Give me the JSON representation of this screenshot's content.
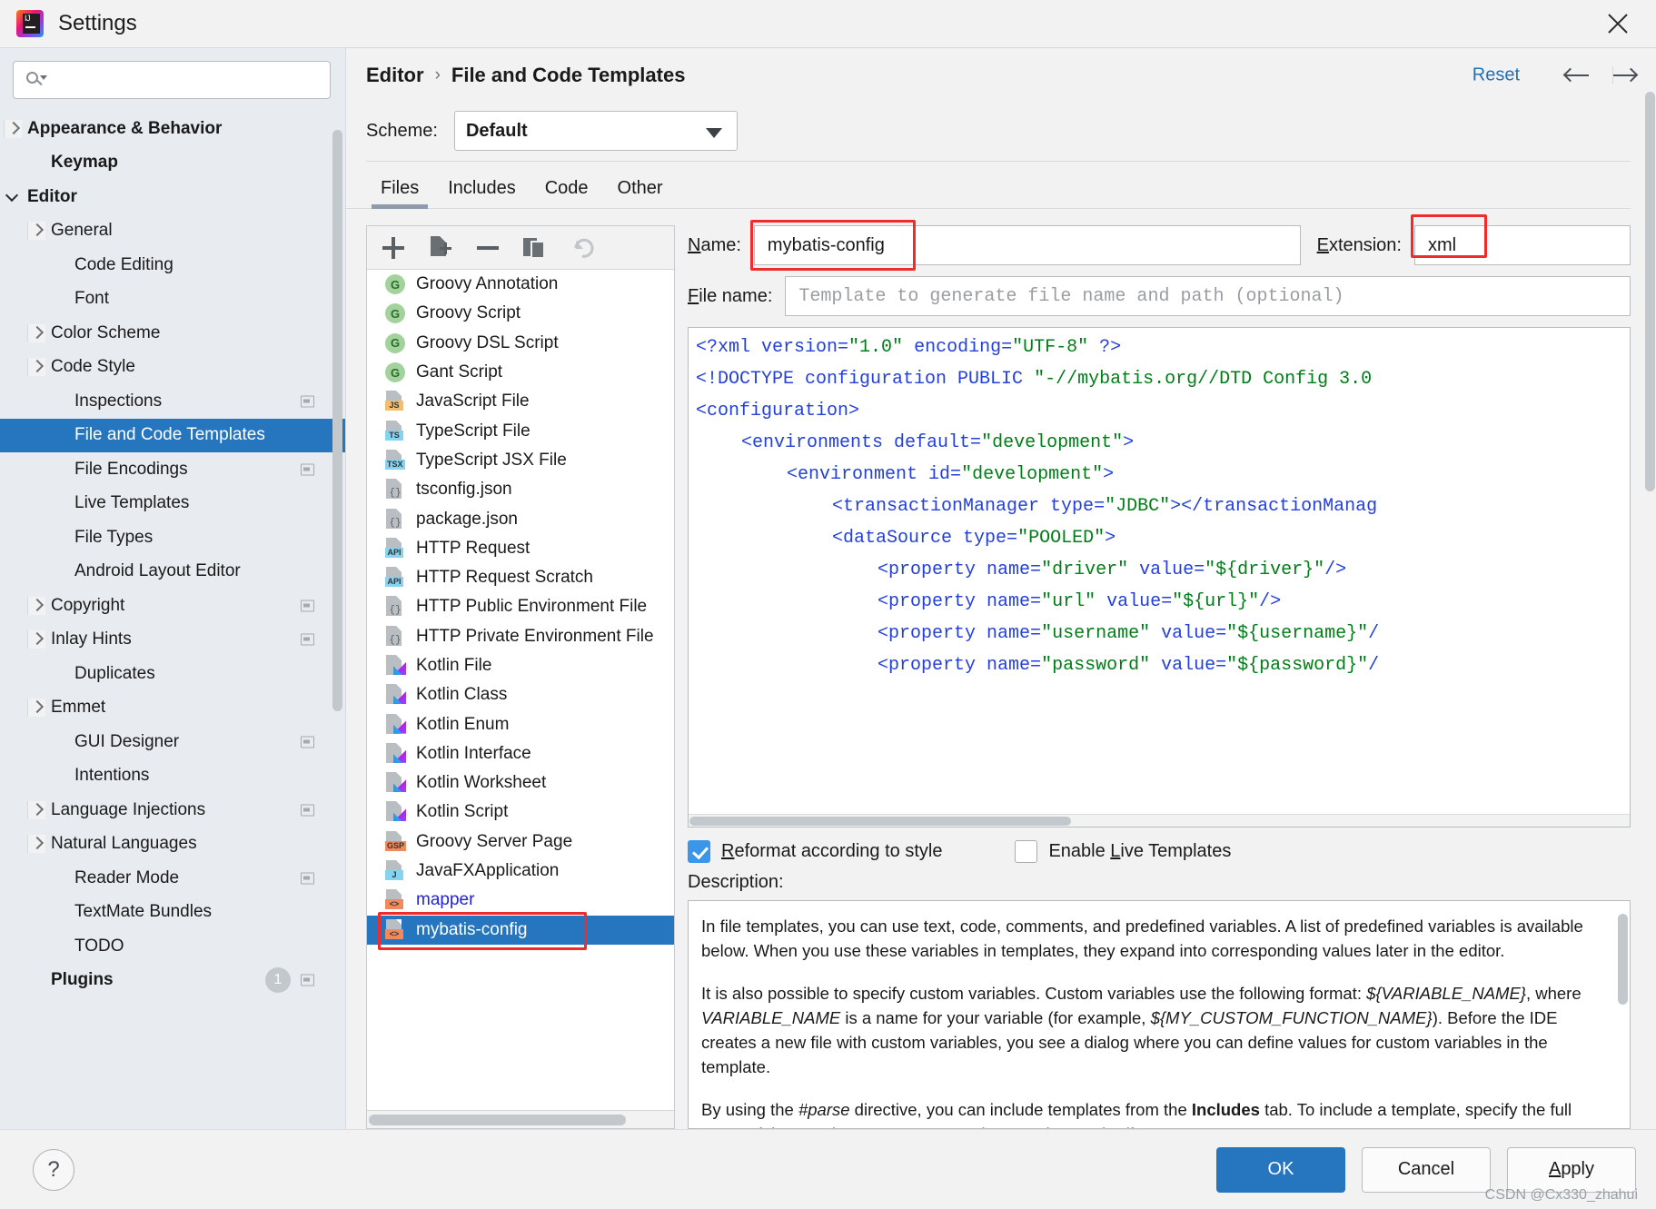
{
  "window": {
    "title": "Settings",
    "logo_text": "IJ",
    "close_icon": "close-icon"
  },
  "search": {
    "placeholder": "",
    "value": "",
    "icon": "search-icon"
  },
  "sidebar": {
    "items": [
      {
        "label": "Appearance & Behavior",
        "arrow": "right",
        "bold": true,
        "indent": 30,
        "selected": false,
        "badge": false
      },
      {
        "label": "Keymap",
        "arrow": "none",
        "bold": true,
        "indent": 56,
        "selected": false,
        "badge": false
      },
      {
        "label": "Editor",
        "arrow": "down",
        "bold": true,
        "indent": 30,
        "selected": false,
        "badge": false
      },
      {
        "label": "General",
        "arrow": "right",
        "bold": false,
        "indent": 56,
        "selected": false,
        "badge": false
      },
      {
        "label": "Code Editing",
        "arrow": "none",
        "bold": false,
        "indent": 82,
        "selected": false,
        "badge": false
      },
      {
        "label": "Font",
        "arrow": "none",
        "bold": false,
        "indent": 82,
        "selected": false,
        "badge": false
      },
      {
        "label": "Color Scheme",
        "arrow": "right",
        "bold": false,
        "indent": 56,
        "selected": false,
        "badge": false
      },
      {
        "label": "Code Style",
        "arrow": "right",
        "bold": false,
        "indent": 56,
        "selected": false,
        "badge": false
      },
      {
        "label": "Inspections",
        "arrow": "none",
        "bold": false,
        "indent": 82,
        "selected": false,
        "badge": true
      },
      {
        "label": "File and Code Templates",
        "arrow": "none",
        "bold": false,
        "indent": 82,
        "selected": true,
        "badge": false
      },
      {
        "label": "File Encodings",
        "arrow": "none",
        "bold": false,
        "indent": 82,
        "selected": false,
        "badge": true
      },
      {
        "label": "Live Templates",
        "arrow": "none",
        "bold": false,
        "indent": 82,
        "selected": false,
        "badge": false
      },
      {
        "label": "File Types",
        "arrow": "none",
        "bold": false,
        "indent": 82,
        "selected": false,
        "badge": false
      },
      {
        "label": "Android Layout Editor",
        "arrow": "none",
        "bold": false,
        "indent": 82,
        "selected": false,
        "badge": false
      },
      {
        "label": "Copyright",
        "arrow": "right",
        "bold": false,
        "indent": 56,
        "selected": false,
        "badge": true
      },
      {
        "label": "Inlay Hints",
        "arrow": "right",
        "bold": false,
        "indent": 56,
        "selected": false,
        "badge": true
      },
      {
        "label": "Duplicates",
        "arrow": "none",
        "bold": false,
        "indent": 82,
        "selected": false,
        "badge": false
      },
      {
        "label": "Emmet",
        "arrow": "right",
        "bold": false,
        "indent": 56,
        "selected": false,
        "badge": false
      },
      {
        "label": "GUI Designer",
        "arrow": "none",
        "bold": false,
        "indent": 82,
        "selected": false,
        "badge": true
      },
      {
        "label": "Intentions",
        "arrow": "none",
        "bold": false,
        "indent": 82,
        "selected": false,
        "badge": false
      },
      {
        "label": "Language Injections",
        "arrow": "right",
        "bold": false,
        "indent": 56,
        "selected": false,
        "badge": true
      },
      {
        "label": "Natural Languages",
        "arrow": "right",
        "bold": false,
        "indent": 56,
        "selected": false,
        "badge": false
      },
      {
        "label": "Reader Mode",
        "arrow": "none",
        "bold": false,
        "indent": 82,
        "selected": false,
        "badge": true
      },
      {
        "label": "TextMate Bundles",
        "arrow": "none",
        "bold": false,
        "indent": 82,
        "selected": false,
        "badge": false
      },
      {
        "label": "TODO",
        "arrow": "none",
        "bold": false,
        "indent": 82,
        "selected": false,
        "badge": false
      },
      {
        "label": "Plugins",
        "arrow": "none",
        "bold": true,
        "indent": 56,
        "selected": false,
        "badge": true,
        "count": "1"
      }
    ]
  },
  "header": {
    "breadcrumb_parent": "Editor",
    "breadcrumb_sep": "›",
    "breadcrumb_current": "File and Code Templates",
    "reset_label": "Reset",
    "back_icon": "arrow-left-icon",
    "forward_icon": "arrow-right-icon"
  },
  "scheme": {
    "label": "Scheme:",
    "value": "Default"
  },
  "tabs": [
    {
      "label": "Files",
      "active": true
    },
    {
      "label": "Includes",
      "active": false
    },
    {
      "label": "Code",
      "active": false
    },
    {
      "label": "Other",
      "active": false
    }
  ],
  "list_toolbar": [
    {
      "name": "add-template-button",
      "icon": "plus-icon"
    },
    {
      "name": "create-child-button",
      "icon": "new-file-icon"
    },
    {
      "name": "remove-template-button",
      "icon": "minus-icon"
    },
    {
      "name": "copy-template-button",
      "icon": "copy-icon"
    },
    {
      "name": "reset-template-button",
      "icon": "undo-icon"
    }
  ],
  "templates": [
    {
      "label": "Groovy Annotation",
      "icon": "groovy",
      "tag": "G",
      "selected": false,
      "link": false
    },
    {
      "label": "Groovy Script",
      "icon": "groovy",
      "tag": "G",
      "selected": false,
      "link": false
    },
    {
      "label": "Groovy DSL Script",
      "icon": "groovy",
      "tag": "G",
      "selected": false,
      "link": false
    },
    {
      "label": "Gant Script",
      "icon": "groovy",
      "tag": "G",
      "selected": false,
      "link": false
    },
    {
      "label": "JavaScript File",
      "icon": "file",
      "tag": "JS",
      "tagbg": "#f5bd6a",
      "selected": false,
      "link": false
    },
    {
      "label": "TypeScript File",
      "icon": "file",
      "tag": "TS",
      "tagbg": "#84d4f0",
      "selected": false,
      "link": false
    },
    {
      "label": "TypeScript JSX File",
      "icon": "file",
      "tag": "TSX",
      "tagbg": "#84d4f0",
      "selected": false,
      "link": false
    },
    {
      "label": "tsconfig.json",
      "icon": "json",
      "tag": "{}",
      "selected": false,
      "link": false
    },
    {
      "label": "package.json",
      "icon": "json",
      "tag": "{}",
      "selected": false,
      "link": false
    },
    {
      "label": "HTTP Request",
      "icon": "file",
      "tag": "API",
      "tagbg": "#84d4f0",
      "selected": false,
      "link": false
    },
    {
      "label": "HTTP Request Scratch",
      "icon": "file",
      "tag": "API",
      "tagbg": "#84d4f0",
      "selected": false,
      "link": false
    },
    {
      "label": "HTTP Public Environment File",
      "icon": "json",
      "tag": "{}",
      "selected": false,
      "link": false
    },
    {
      "label": "HTTP Private Environment File",
      "icon": "json",
      "tag": "{}",
      "selected": false,
      "link": false
    },
    {
      "label": "Kotlin File",
      "icon": "kotlin",
      "tag": "",
      "selected": false,
      "link": false
    },
    {
      "label": "Kotlin Class",
      "icon": "kotlin",
      "tag": "",
      "selected": false,
      "link": false
    },
    {
      "label": "Kotlin Enum",
      "icon": "kotlin",
      "tag": "",
      "selected": false,
      "link": false
    },
    {
      "label": "Kotlin Interface",
      "icon": "kotlin",
      "tag": "",
      "selected": false,
      "link": false
    },
    {
      "label": "Kotlin Worksheet",
      "icon": "kotlin",
      "tag": "",
      "selected": false,
      "link": false
    },
    {
      "label": "Kotlin Script",
      "icon": "kotlin",
      "tag": "",
      "selected": false,
      "link": false
    },
    {
      "label": "Groovy Server Page",
      "icon": "file",
      "tag": "GSP",
      "tagbg": "#f08a5d",
      "selected": false,
      "link": false
    },
    {
      "label": "JavaFXApplication",
      "icon": "file",
      "tag": "J",
      "tagbg": "#84d4f0",
      "selected": false,
      "link": false
    },
    {
      "label": "mapper",
      "icon": "file",
      "tag": "<>",
      "tagbg": "#f08a5d",
      "selected": false,
      "link": true
    },
    {
      "label": "mybatis-config",
      "icon": "file",
      "tag": "<>",
      "tagbg": "#f08a5d",
      "selected": true,
      "link": false
    }
  ],
  "form": {
    "name_label": "Name:",
    "name_label_mnemonic": "N",
    "name_value": "mybatis-config",
    "extension_label": "Extension:",
    "extension_label_mnemonic": "E",
    "extension_value": "xml",
    "filename_label": "File name:",
    "filename_label_mnemonic": "F",
    "filename_placeholder": "Template to generate file name and path (optional)",
    "filename_value": ""
  },
  "code_lines": [
    {
      "indent": 0,
      "parts": [
        {
          "t": "<?xml ",
          "c": "tag"
        },
        {
          "t": "version",
          "c": "attr"
        },
        {
          "t": "=",
          "c": "tag"
        },
        {
          "t": "\"1.0\"",
          "c": "val"
        },
        {
          "t": " encoding",
          "c": "attr"
        },
        {
          "t": "=",
          "c": "tag"
        },
        {
          "t": "\"UTF-8\"",
          "c": "val"
        },
        {
          "t": " ?>",
          "c": "tag"
        }
      ]
    },
    {
      "indent": 0,
      "parts": [
        {
          "t": "<!DOCTYPE configuration PUBLIC ",
          "c": "tag"
        },
        {
          "t": "\"-//mybatis.org//DTD Config 3.0",
          "c": "val"
        }
      ]
    },
    {
      "indent": 0,
      "parts": [
        {
          "t": "<configuration>",
          "c": "tag"
        }
      ]
    },
    {
      "indent": 1,
      "parts": [
        {
          "t": "<environments ",
          "c": "tag"
        },
        {
          "t": "default",
          "c": "attr"
        },
        {
          "t": "=",
          "c": "tag"
        },
        {
          "t": "\"development\"",
          "c": "val"
        },
        {
          "t": ">",
          "c": "tag"
        }
      ]
    },
    {
      "indent": 2,
      "parts": [
        {
          "t": "<environment ",
          "c": "tag"
        },
        {
          "t": "id",
          "c": "attr"
        },
        {
          "t": "=",
          "c": "tag"
        },
        {
          "t": "\"development\"",
          "c": "val"
        },
        {
          "t": ">",
          "c": "tag"
        }
      ]
    },
    {
      "indent": 3,
      "parts": [
        {
          "t": "<transactionManager ",
          "c": "tag"
        },
        {
          "t": "type",
          "c": "attr"
        },
        {
          "t": "=",
          "c": "tag"
        },
        {
          "t": "\"JDBC\"",
          "c": "val"
        },
        {
          "t": "></transactionManag",
          "c": "tag"
        }
      ]
    },
    {
      "indent": 3,
      "parts": [
        {
          "t": "<dataSource ",
          "c": "tag"
        },
        {
          "t": "type",
          "c": "attr"
        },
        {
          "t": "=",
          "c": "tag"
        },
        {
          "t": "\"POOLED\"",
          "c": "val"
        },
        {
          "t": ">",
          "c": "tag"
        }
      ]
    },
    {
      "indent": 4,
      "parts": [
        {
          "t": "<property ",
          "c": "tag"
        },
        {
          "t": "name",
          "c": "attr"
        },
        {
          "t": "=",
          "c": "tag"
        },
        {
          "t": "\"driver\"",
          "c": "val"
        },
        {
          "t": " value",
          "c": "attr"
        },
        {
          "t": "=",
          "c": "tag"
        },
        {
          "t": "\"${driver}\"",
          "c": "val"
        },
        {
          "t": "/>",
          "c": "tag"
        }
      ]
    },
    {
      "indent": 4,
      "parts": [
        {
          "t": "<property ",
          "c": "tag"
        },
        {
          "t": "name",
          "c": "attr"
        },
        {
          "t": "=",
          "c": "tag"
        },
        {
          "t": "\"url\"",
          "c": "val"
        },
        {
          "t": " value",
          "c": "attr"
        },
        {
          "t": "=",
          "c": "tag"
        },
        {
          "t": "\"${url}\"",
          "c": "val"
        },
        {
          "t": "/>",
          "c": "tag"
        }
      ]
    },
    {
      "indent": 4,
      "parts": [
        {
          "t": "<property ",
          "c": "tag"
        },
        {
          "t": "name",
          "c": "attr"
        },
        {
          "t": "=",
          "c": "tag"
        },
        {
          "t": "\"username\"",
          "c": "val"
        },
        {
          "t": " value",
          "c": "attr"
        },
        {
          "t": "=",
          "c": "tag"
        },
        {
          "t": "\"${username}\"",
          "c": "val"
        },
        {
          "t": "/",
          "c": "tag"
        }
      ]
    },
    {
      "indent": 4,
      "parts": [
        {
          "t": "<property ",
          "c": "tag"
        },
        {
          "t": "name",
          "c": "attr"
        },
        {
          "t": "=",
          "c": "tag"
        },
        {
          "t": "\"password\"",
          "c": "val"
        },
        {
          "t": " value",
          "c": "attr"
        },
        {
          "t": "=",
          "c": "tag"
        },
        {
          "t": "\"${password}\"",
          "c": "val"
        },
        {
          "t": "/",
          "c": "tag"
        }
      ]
    }
  ],
  "options": {
    "reformat_label": "Reformat according to style",
    "reformat_mnemonic": "R",
    "reformat_checked": true,
    "live_templates_label": "Enable Live Templates",
    "live_templates_mnemonic": "L",
    "live_templates_checked": false
  },
  "description": {
    "label": "Description:",
    "p1": "In file templates, you can use text, code, comments, and predefined variables. A list of predefined variables is available below. When you use these variables in templates, they expand into corresponding values later in the editor.",
    "p2_a": "It is also possible to specify custom variables. Custom variables use the following format: ",
    "p2_i1": "${VARIABLE_NAME}",
    "p2_b": ", where ",
    "p2_i2": "VARIABLE_NAME",
    "p2_c": " is a name for your variable (for example, ",
    "p2_i3": "${MY_CUSTOM_FUNCTION_NAME}",
    "p2_d": "). Before the IDE creates a new file with custom variables, you see a dialog where you can define values for custom variables in the template.",
    "p3_a": "By using the ",
    "p3_i1": "#parse",
    "p3_b": " directive, you can include templates from the ",
    "p3_bold": "Includes",
    "p3_c": " tab. To include a template, specify the full name of the template as a parameter in quotation marks (for"
  },
  "footer": {
    "help_label": "?",
    "ok_label": "OK",
    "cancel_label": "Cancel",
    "apply_label": "Apply",
    "apply_mnemonic": "A"
  },
  "watermark": "CSDN @Cx330_zhahui",
  "colors": {
    "accent": "#2675bf",
    "link": "#2470b3",
    "highlight_box": "#ef2b2b",
    "sidebar_bg": "#e8ecf0"
  }
}
